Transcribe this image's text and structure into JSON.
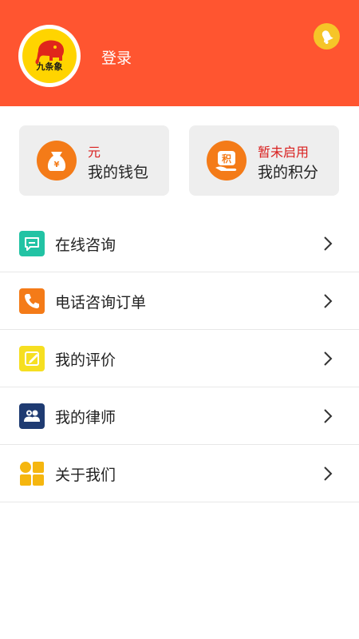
{
  "header": {
    "brand_text": "九条象",
    "login_label": "登录"
  },
  "cards": [
    {
      "top": "元",
      "bottom": "我的钱包",
      "icon": "money-bag-icon"
    },
    {
      "top": "暂未启用",
      "bottom": "我的积分",
      "icon": "points-icon"
    }
  ],
  "menu": {
    "items": [
      {
        "label": "在线咨询",
        "icon": "chat-icon",
        "color": "#22c3a4"
      },
      {
        "label": "电话咨询订单",
        "icon": "phone-icon",
        "color": "#f47b18"
      },
      {
        "label": "我的评价",
        "icon": "edit-icon",
        "color": "#f6df21"
      },
      {
        "label": "我的律师",
        "icon": "people-icon",
        "color": "#1f3b72"
      },
      {
        "label": "关于我们",
        "icon": "grid-icon",
        "color": "#f5b60f"
      }
    ]
  },
  "colors": {
    "header": "#ff5530",
    "accent_red": "#d9201f",
    "card_icon": "#f47b18"
  }
}
